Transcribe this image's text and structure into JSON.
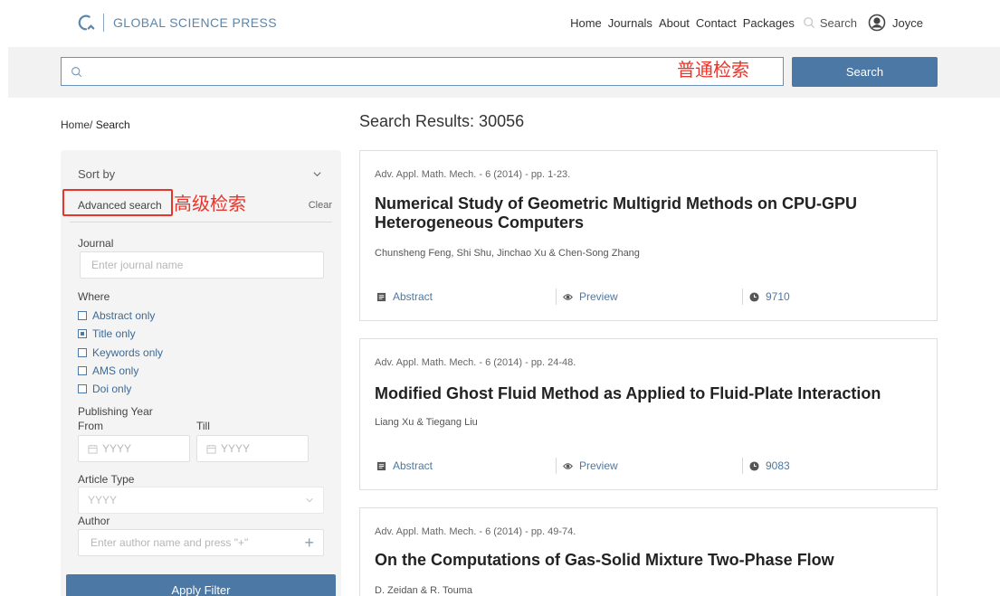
{
  "header": {
    "brand": "GLOBAL SCIENCE PRESS",
    "nav": [
      "Home",
      "Journals",
      "About",
      "Contact",
      "Packages"
    ],
    "search_label": "Search",
    "user_name": "Joyce"
  },
  "search": {
    "placeholder": "",
    "annotation": "普通检索",
    "button_label": "Search"
  },
  "breadcrumb": {
    "home": "Home/",
    "current": "Search"
  },
  "results": {
    "title": "Search Results: 30056"
  },
  "filters": {
    "sort_label": "Sort by",
    "advanced_label": "Advanced search",
    "advanced_annotation": "高级检索",
    "clear_label": "Clear",
    "journal_label": "Journal",
    "journal_placeholder": "Enter journal name",
    "where_label": "Where",
    "where_options": [
      {
        "label": "Abstract only",
        "checked": false
      },
      {
        "label": "Title only",
        "checked": true
      },
      {
        "label": "Keywords only",
        "checked": false
      },
      {
        "label": "AMS only",
        "checked": false
      },
      {
        "label": "Doi only",
        "checked": false
      }
    ],
    "year_label": "Publishing Year",
    "from_label": "From",
    "till_label": "Till",
    "from_placeholder": "YYYY",
    "till_placeholder": "YYYY",
    "article_type_label": "Article Type",
    "article_type_value": "YYYY",
    "author_label": "Author",
    "author_placeholder": "Enter author name and press \"+\"",
    "apply_label": "Apply Filter"
  },
  "articles": [
    {
      "meta": "Adv. Appl. Math. Mech. - 6 (2014) - pp. 1-23.",
      "title": "Numerical Study of Geometric Multigrid Methods on CPU-GPU Heterogeneous Computers",
      "authors": "Chunsheng Feng, Shi Shu, Jinchao Xu & Chen-Song Zhang",
      "abstract_label": "Abstract",
      "preview_label": "Preview",
      "views": "9710"
    },
    {
      "meta": "Adv. Appl. Math. Mech. - 6 (2014) - pp. 24-48.",
      "title": "Modified Ghost Fluid Method as Applied to Fluid-Plate Interaction",
      "authors": "Liang Xu & Tiegang Liu",
      "abstract_label": "Abstract",
      "preview_label": "Preview",
      "views": "9083"
    },
    {
      "meta": "Adv. Appl. Math. Mech. - 6 (2014) - pp. 49-74.",
      "title": "On the Computations of Gas-Solid Mixture Two-Phase Flow",
      "authors": "D. Zeidan & R. Touma"
    }
  ],
  "colors": {
    "brand": "#5b86ad",
    "button": "#4b78a5",
    "annotation": "#e8352b"
  }
}
